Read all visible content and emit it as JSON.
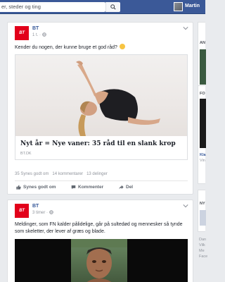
{
  "topbar": {
    "search_placeholder": "er, steder og ting",
    "profile_name": "Martin"
  },
  "colors": {
    "brand": "#3b5998",
    "bt_red": "#e2001a",
    "link": "#365899"
  },
  "posts": [
    {
      "page_logo": "BT",
      "page_name": "BT",
      "time": "1 t.",
      "privacy_icon": "globe-icon",
      "text": "Kender du nogen, der kunne bruge et god råd?",
      "link": {
        "title": "Nyt år = Nye vaner: 35 råd til en slank krop",
        "domain": "BT.DK"
      },
      "stats": {
        "likes": "35 Synes godt om",
        "comments": "14 kommentarer",
        "shares": "13 delinger"
      },
      "actions": {
        "like": "Synes godt om",
        "comment": "Kommenter",
        "share": "Del"
      }
    },
    {
      "page_logo": "BT",
      "page_name": "BT",
      "time": "3 timer",
      "privacy_icon": "globe-icon",
      "text": "Meldinger, som FN kalder pålidelige, går på sultedød og mennesker så tynde som skeletter, der lever af græs og blade."
    }
  ],
  "sidebar": {
    "items": [
      "AN",
      "FO",
      "Kla",
      "Vin",
      "NY",
      "Dan",
      "Vilk",
      "Me",
      "Face"
    ]
  }
}
